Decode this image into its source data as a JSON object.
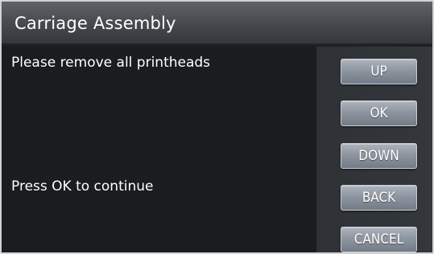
{
  "title_bar": {
    "title": "Carriage Assembly"
  },
  "content": {
    "instruction": "Please remove all printheads",
    "prompt": "Press OK to continue"
  },
  "buttons": {
    "up": "UP",
    "ok": "OK",
    "down": "DOWN",
    "back": "BACK",
    "cancel": "CANCEL"
  },
  "colors": {
    "background": "#1a1c1f",
    "title_bar": "#45494e",
    "button": "#8d95a0",
    "text": "#ffffff"
  }
}
